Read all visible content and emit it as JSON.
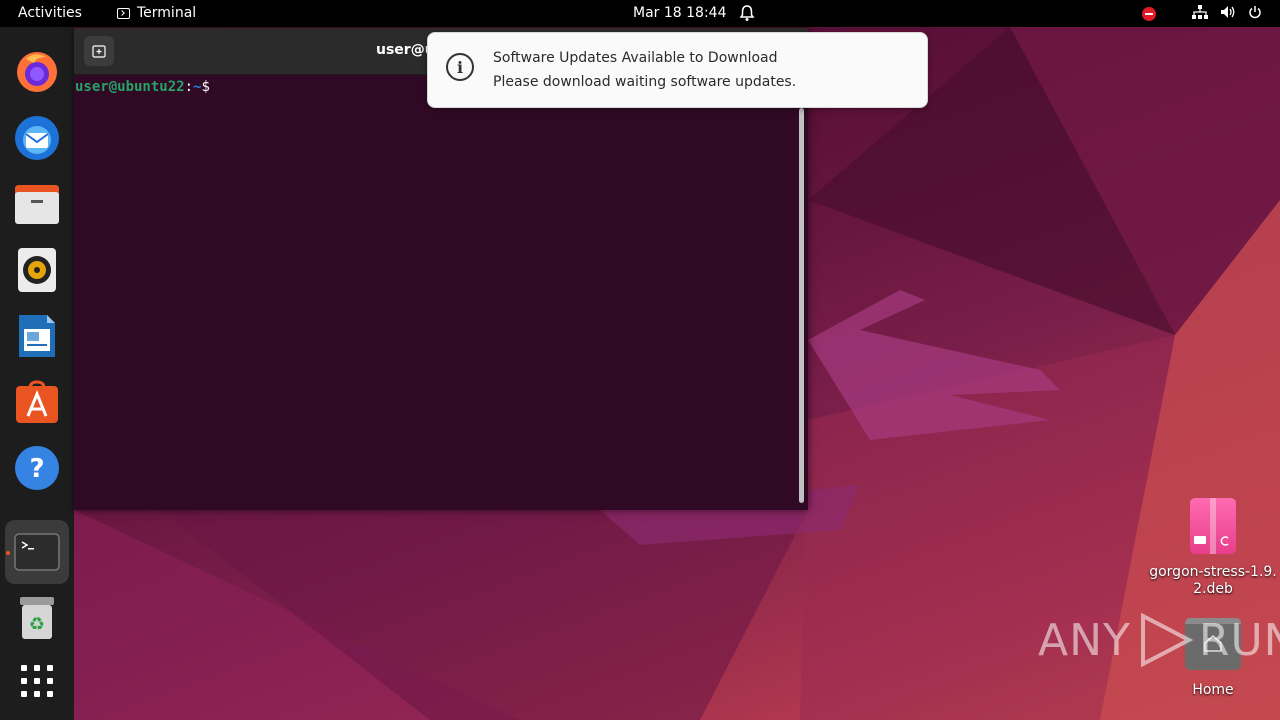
{
  "topbar": {
    "activities": "Activities",
    "app_name": "Terminal",
    "clock": "Mar 18  18:44"
  },
  "dock": {
    "items": [
      {
        "name": "Firefox",
        "icon": "firefox-icon"
      },
      {
        "name": "Thunderbird",
        "icon": "thunderbird-icon"
      },
      {
        "name": "Files",
        "icon": "files-icon"
      },
      {
        "name": "Rhythmbox",
        "icon": "rhythmbox-icon"
      },
      {
        "name": "LibreOffice Writer",
        "icon": "writer-icon"
      },
      {
        "name": "Ubuntu Software",
        "icon": "software-icon"
      },
      {
        "name": "Help",
        "icon": "help-icon"
      },
      {
        "name": "Terminal",
        "icon": "terminal-icon",
        "active": true
      },
      {
        "name": "Trash",
        "icon": "trash-icon"
      },
      {
        "name": "Show Applications",
        "icon": "apps-grid-icon"
      }
    ]
  },
  "terminal": {
    "title": "user@u",
    "prompt_user": "user@ubuntu22",
    "prompt_sep": ":",
    "prompt_path": "~",
    "prompt_symbol": "$"
  },
  "notification": {
    "title": "Software Updates Available to Download",
    "body": "Please download waiting software updates."
  },
  "desktop": {
    "file_label_line1": "gorgon-stress-1.9.",
    "file_label_line2": "2.deb",
    "home_label": "Home"
  },
  "watermark": {
    "text_left": "ANY",
    "text_right": "RUN"
  },
  "colors": {
    "terminal_bg": "#300a24",
    "prompt_user": "#26a269",
    "prompt_path": "#2a7bde",
    "accent": "#e95420"
  }
}
